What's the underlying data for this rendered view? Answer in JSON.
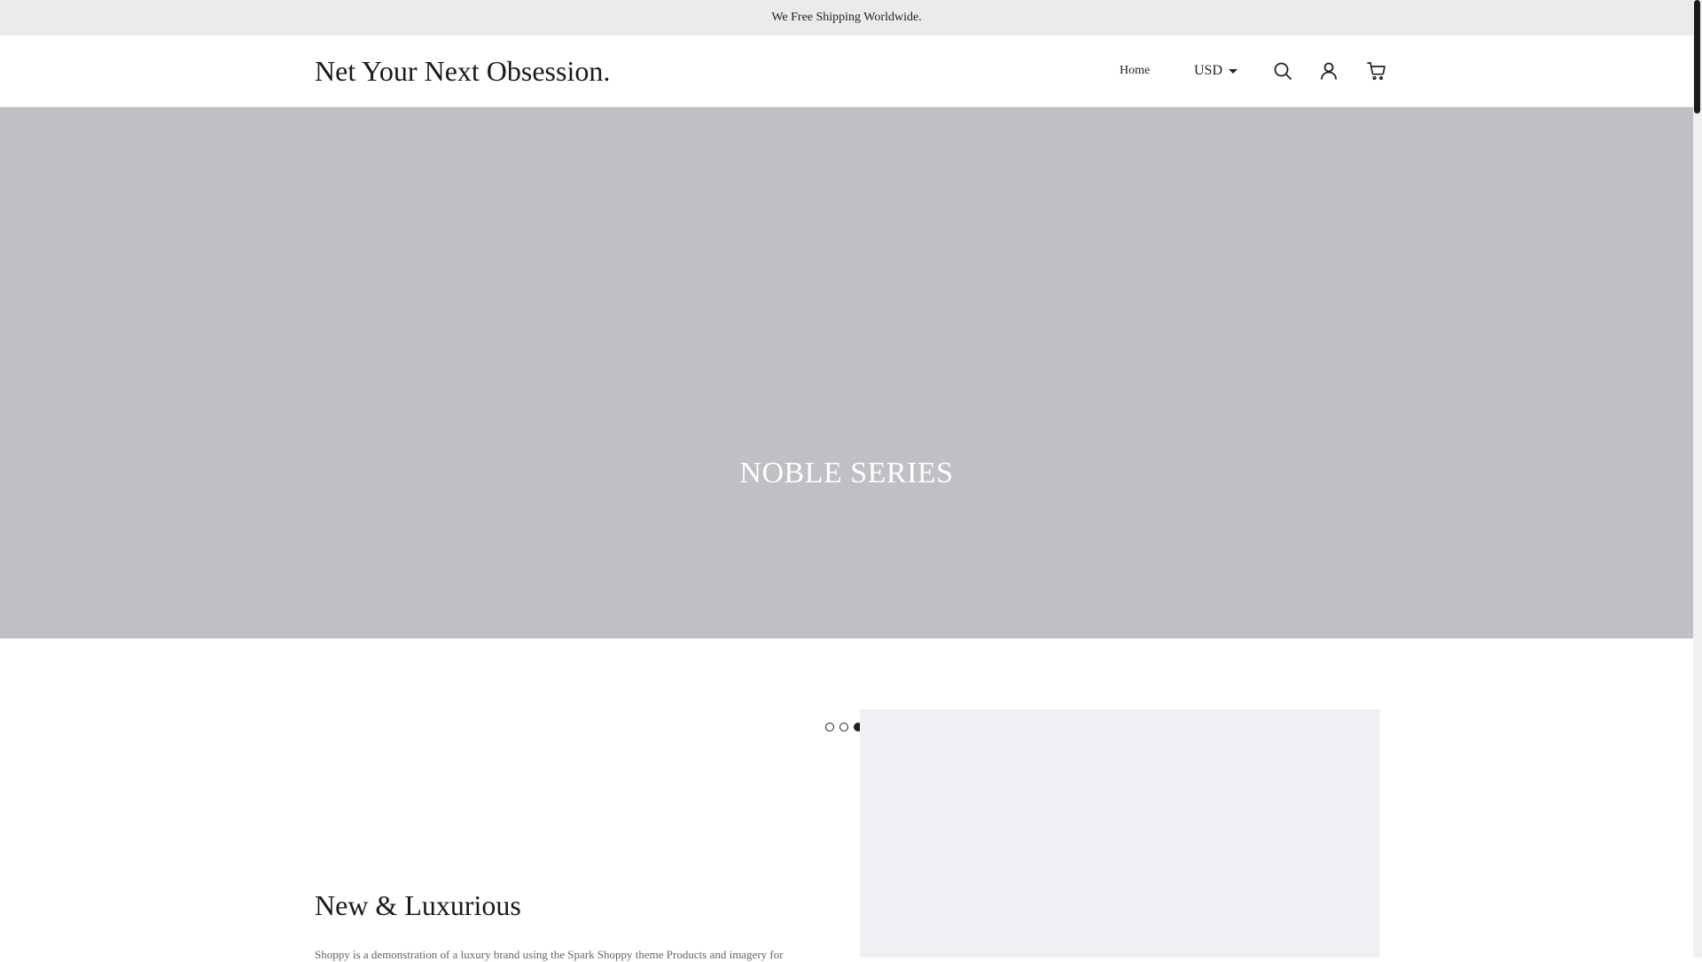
{
  "announcement": "We Free Shipping Worldwide.",
  "header": {
    "logo": "Net Your Next Obsession.",
    "nav": {
      "home": "Home"
    },
    "currency": {
      "selected": "USD"
    },
    "icons": [
      "search-icon",
      "account-icon",
      "cart-icon"
    ]
  },
  "hero": {
    "title": "NOBLE SERIES",
    "slide_count": 3,
    "active_slide": 3
  },
  "section": {
    "title": "New & Luxurious",
    "text": "Shoppy is a demonstration of a luxury brand using the Spark Shoppy theme Products and imagery for"
  },
  "colors": {
    "announcement_bg": "#ebebeb",
    "hero_bg": "#bfc0c4",
    "feature_image_bg": "#efeff4",
    "text": "#222222"
  }
}
